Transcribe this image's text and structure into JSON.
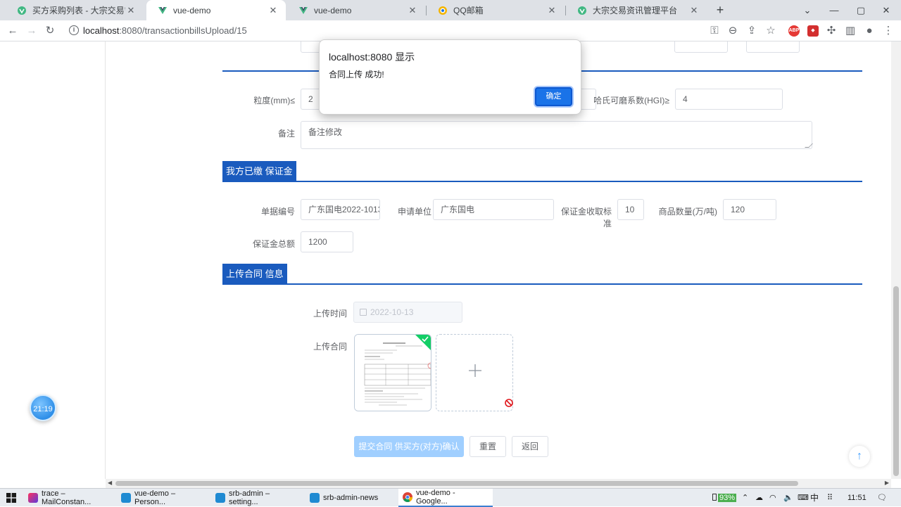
{
  "browser": {
    "tabs": [
      {
        "title": "买方采购列表 - 大宗交易管理平台",
        "active": false
      },
      {
        "title": "vue-demo",
        "active": true
      },
      {
        "title": "vue-demo",
        "active": false
      },
      {
        "title": "QQ邮箱",
        "active": false
      },
      {
        "title": "大宗交易资讯管理平台",
        "active": false
      }
    ],
    "url_host": "localhost",
    "url_rest": ":8080/transactionbillsUpload/15"
  },
  "form": {
    "granularity_label": "粒度(mm)≤",
    "granularity_value": "2",
    "hgi_label": "哈氏可磨系数(HGI)≥",
    "hgi_value": "4",
    "remark_label": "备注",
    "remark_value": "备注修改"
  },
  "deposit": {
    "section_title": "我方已缴 保证金",
    "bill_no_label": "单据编号",
    "bill_no_value": "广东国电2022-1013",
    "applicant_label": "申请单位",
    "applicant_value": "广东国电",
    "standard_label": "保证金收取标准",
    "standard_value": "10",
    "quantity_label": "商品数量(万/吨)",
    "quantity_value": "120",
    "total_label": "保证金总额",
    "total_value": "1200"
  },
  "contract": {
    "section_title": "上传合同 信息",
    "upload_time_label": "上传时间",
    "upload_time_value": "2022-10-13",
    "upload_label": "上传合同"
  },
  "actions": {
    "submit_label": "提交合同 供买方(对方)确认",
    "reset_label": "重置",
    "back_label": "返回"
  },
  "alert": {
    "title": "localhost:8080 显示",
    "message": "合同上传 成功!",
    "ok_label": "确定"
  },
  "float_clock": "21:19",
  "taskbar": {
    "items": [
      {
        "title": "trace – MailConstan..."
      },
      {
        "title": "vue-demo – Person..."
      },
      {
        "title": "srb-admin – setting..."
      },
      {
        "title": "srb-admin-news"
      },
      {
        "title": "vue-demo - Google..."
      }
    ],
    "battery": "93%",
    "ime": "中",
    "clock": "11:51"
  },
  "colors": {
    "section_blue": "#1a5bbe",
    "primary_disabled": "#a0cfff",
    "chrome_blue": "#1a73e8"
  }
}
